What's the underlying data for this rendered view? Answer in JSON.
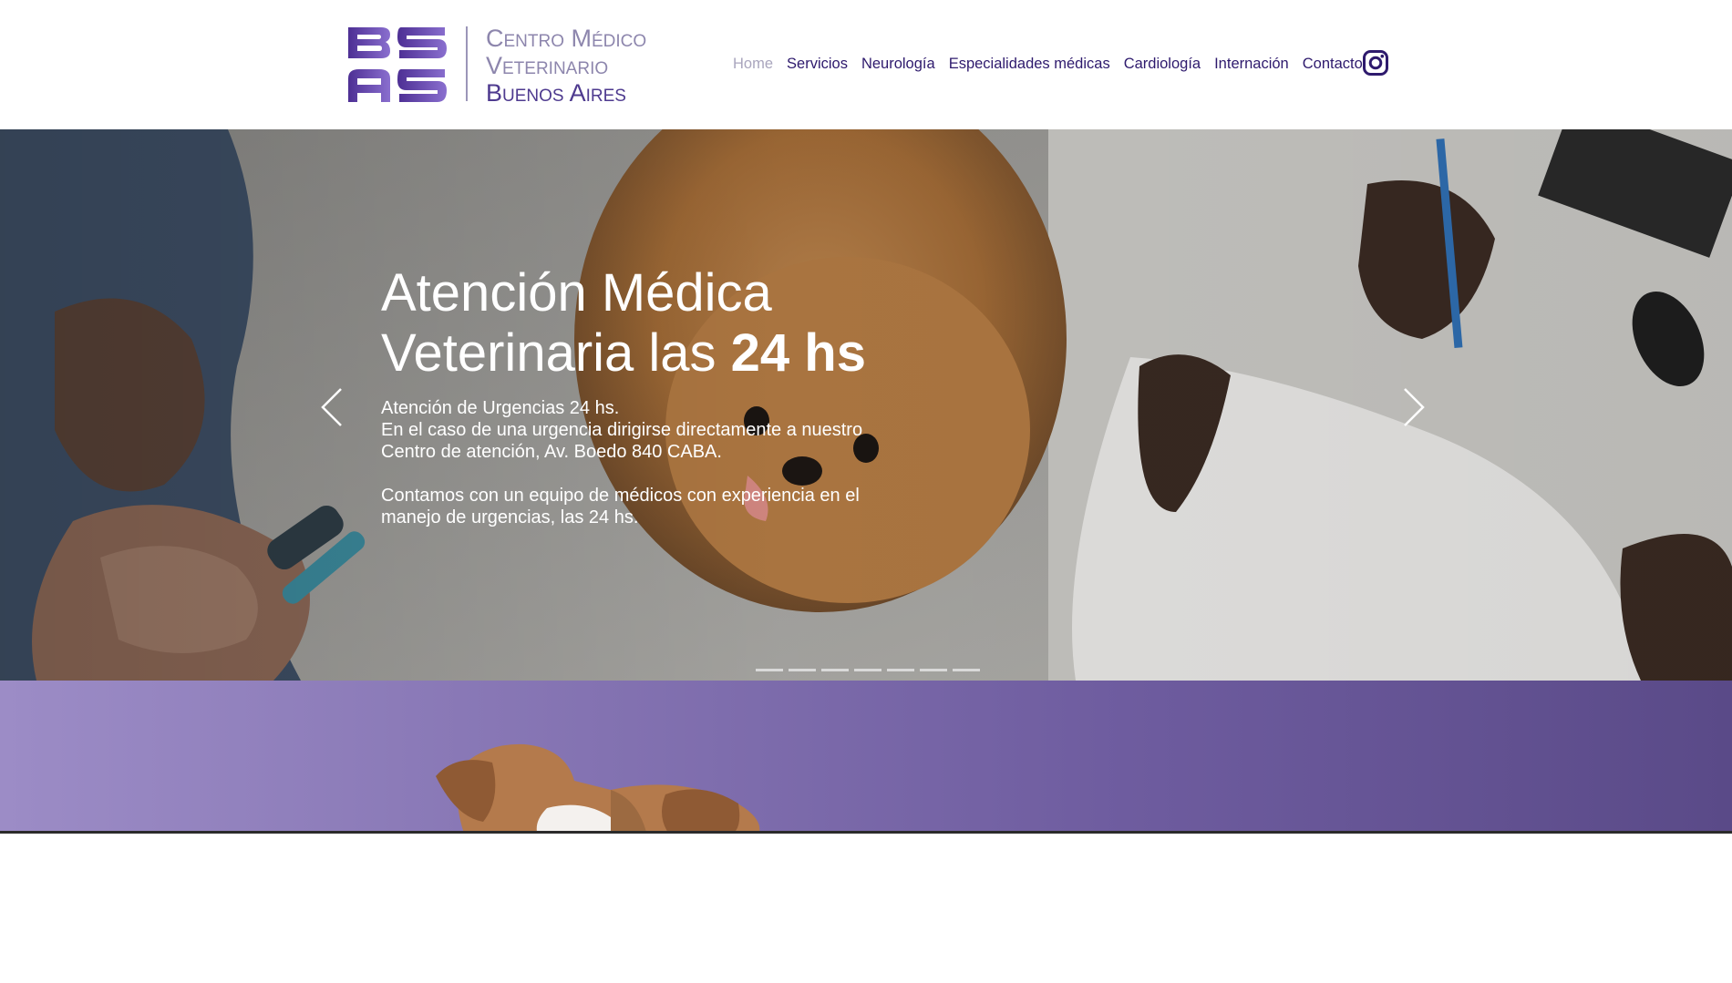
{
  "header": {
    "logo": {
      "mark": "BS AS",
      "line1": "Centro Médico",
      "line2": "Veterinario",
      "line3": "Buenos Aires"
    },
    "nav": [
      {
        "label": "Home",
        "active": true
      },
      {
        "label": "Servicios",
        "active": false
      },
      {
        "label": "Neurología",
        "active": false
      },
      {
        "label": "Especialidades médicas",
        "active": false
      },
      {
        "label": "Cardiología",
        "active": false
      },
      {
        "label": "Internación",
        "active": false
      },
      {
        "label": "Contacto",
        "active": false
      }
    ],
    "social_icon": "instagram-icon"
  },
  "hero": {
    "title_line1": "Atención Médica",
    "title_line2_prefix": "Veterinaria las ",
    "title_line2_bold": "24 hs",
    "paragraphs": [
      "Atención de Urgencias 24 hs.",
      "En el caso de una urgencia dirigirse directamente a nuestro Centro de atención, Av. Boedo 840 CABA.",
      "Contamos con un equipo de médicos con experiencia en el manejo de urgencias, las 24 hs."
    ],
    "slide_count": 7,
    "prev_icon": "chevron-left-icon",
    "next_icon": "chevron-right-icon"
  },
  "colors": {
    "brand_purple": "#4e3a8f",
    "nav_text": "#2e1a6d",
    "nav_active": "#a9a5bd",
    "band_start": "#9c8cc6",
    "band_end": "#5a4a88"
  }
}
